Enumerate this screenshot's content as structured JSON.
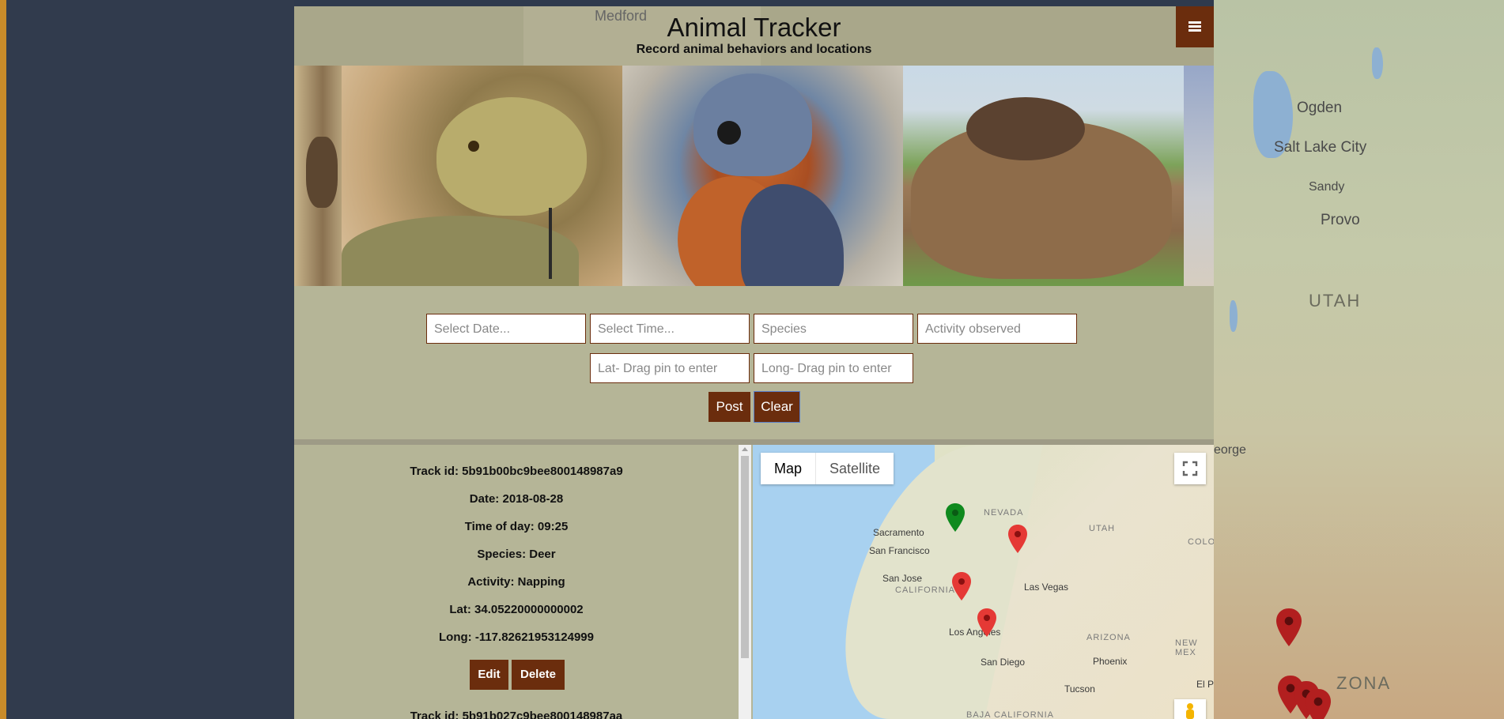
{
  "header": {
    "title": "Animal Tracker",
    "subtitle": "Record animal behaviors and locations",
    "menu_icon": "hamburger-menu-icon",
    "background_map_label": "Medford"
  },
  "carousel": {
    "slides": [
      "deer",
      "rattlesnake",
      "kestrel",
      "bear with cub",
      "landscape"
    ]
  },
  "form": {
    "date_placeholder": "Select Date...",
    "time_placeholder": "Select Time...",
    "species_placeholder": "Species",
    "activity_placeholder": "Activity observed",
    "lat_placeholder": "Lat- Drag pin to enter",
    "long_placeholder": "Long- Drag pin to enter",
    "post_label": "Post",
    "clear_label": "Clear"
  },
  "records": [
    {
      "track_id": "Track id: 5b91b00bc9bee800148987a9",
      "date": "Date: 2018-08-28",
      "time": "Time of day: 09:25",
      "species": "Species: Deer",
      "activity": "Activity: Napping",
      "lat": "Lat: 34.05220000000002",
      "long": "Long: -117.82621953124999",
      "edit_label": "Edit",
      "delete_label": "Delete"
    },
    {
      "track_id": "Track id: 5b91b027c9bee800148987aa"
    }
  ],
  "map": {
    "tabs": [
      "Map",
      "Satellite"
    ],
    "active_tab": "Map",
    "cities": [
      "Sacramento",
      "San Francisco",
      "San Jose",
      "Las Vegas",
      "Los Angeles",
      "San Diego",
      "Phoenix",
      "Tucson",
      "El P"
    ],
    "states": [
      "NEVADA",
      "UTAH",
      "CALIFORNIA",
      "ARIZONA",
      "NEW MEX",
      "COLO",
      "BAJA CALIFORNIA"
    ],
    "pins": {
      "green": 1,
      "red": 3
    },
    "pin_colors": {
      "green": "#0f8a1e",
      "red": "#e53935"
    }
  },
  "background_map": {
    "cities": [
      "Ogden",
      "Salt Lake City",
      "Sandy",
      "Provo",
      "eorge"
    ],
    "states": [
      "UTAH",
      "ZONA"
    ]
  },
  "colors": {
    "accent": "#6b2d0d",
    "card_bg": "#b5b597",
    "page_bg": "#2f3a4d"
  }
}
